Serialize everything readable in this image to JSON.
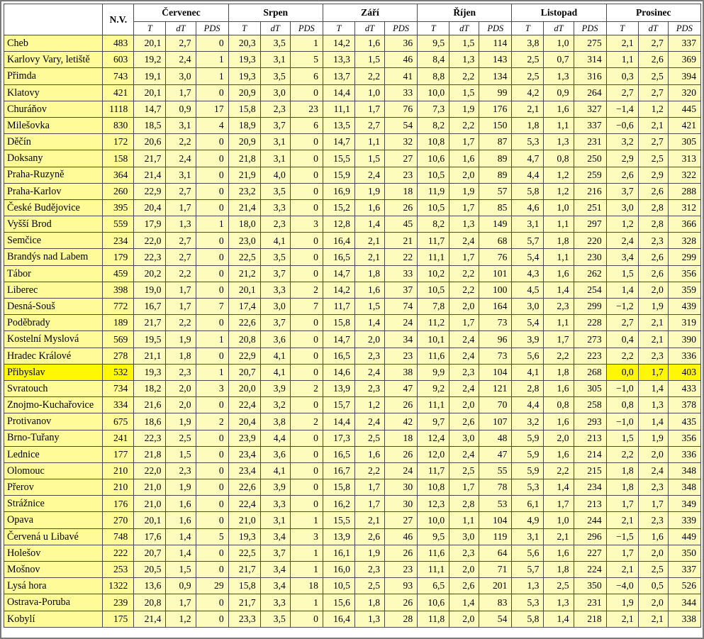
{
  "header": {
    "nv_label": "N.V.",
    "months": [
      "Červenec",
      "Srpen",
      "Září",
      "Říjen",
      "Listopad",
      "Prosinec"
    ],
    "subcols": [
      "T",
      "dT",
      "PDS"
    ]
  },
  "highlight_color": "#fff704",
  "rows": [
    {
      "name": "Cheb",
      "nv": "483",
      "v": [
        "20,1",
        "2,7",
        "0",
        "20,3",
        "3,5",
        "1",
        "14,2",
        "1,6",
        "36",
        "9,5",
        "1,5",
        "114",
        "3,8",
        "1,0",
        "275",
        "2,1",
        "2,7",
        "337"
      ]
    },
    {
      "name": "Karlovy Vary, letiště",
      "nv": "603",
      "v": [
        "19,2",
        "2,4",
        "1",
        "19,3",
        "3,1",
        "5",
        "13,3",
        "1,5",
        "46",
        "8,4",
        "1,3",
        "143",
        "2,5",
        "0,7",
        "314",
        "1,1",
        "2,6",
        "369"
      ]
    },
    {
      "name": "Přimda",
      "nv": "743",
      "v": [
        "19,1",
        "3,0",
        "1",
        "19,3",
        "3,5",
        "6",
        "13,7",
        "2,2",
        "41",
        "8,8",
        "2,2",
        "134",
        "2,5",
        "1,3",
        "316",
        "0,3",
        "2,5",
        "394"
      ]
    },
    {
      "name": "Klatovy",
      "nv": "421",
      "v": [
        "20,1",
        "1,7",
        "0",
        "20,9",
        "3,0",
        "0",
        "14,4",
        "1,0",
        "33",
        "10,0",
        "1,5",
        "99",
        "4,2",
        "0,9",
        "264",
        "2,7",
        "2,7",
        "320"
      ]
    },
    {
      "name": "Churáňov",
      "nv": "1118",
      "v": [
        "14,7",
        "0,9",
        "17",
        "15,8",
        "2,3",
        "23",
        "11,1",
        "1,7",
        "76",
        "7,3",
        "1,9",
        "176",
        "2,1",
        "1,6",
        "327",
        "−1,4",
        "1,2",
        "445"
      ]
    },
    {
      "name": "Milešovka",
      "nv": "830",
      "v": [
        "18,5",
        "3,1",
        "4",
        "18,9",
        "3,7",
        "6",
        "13,5",
        "2,7",
        "54",
        "8,2",
        "2,2",
        "150",
        "1,8",
        "1,1",
        "337",
        "−0,6",
        "2,1",
        "421"
      ]
    },
    {
      "name": "Děčín",
      "nv": "172",
      "v": [
        "20,6",
        "2,2",
        "0",
        "20,9",
        "3,1",
        "0",
        "14,7",
        "1,1",
        "32",
        "10,8",
        "1,7",
        "87",
        "5,3",
        "1,3",
        "231",
        "3,2",
        "2,7",
        "305"
      ]
    },
    {
      "name": "Doksany",
      "nv": "158",
      "v": [
        "21,7",
        "2,4",
        "0",
        "21,8",
        "3,1",
        "0",
        "15,5",
        "1,5",
        "27",
        "10,6",
        "1,6",
        "89",
        "4,7",
        "0,8",
        "250",
        "2,9",
        "2,5",
        "313"
      ]
    },
    {
      "name": "Praha-Ruzyně",
      "nv": "364",
      "v": [
        "21,4",
        "3,1",
        "0",
        "21,9",
        "4,0",
        "0",
        "15,9",
        "2,4",
        "23",
        "10,5",
        "2,0",
        "89",
        "4,4",
        "1,2",
        "259",
        "2,6",
        "2,9",
        "322"
      ]
    },
    {
      "name": "Praha-Karlov",
      "nv": "260",
      "v": [
        "22,9",
        "2,7",
        "0",
        "23,2",
        "3,5",
        "0",
        "16,9",
        "1,9",
        "18",
        "11,9",
        "1,9",
        "57",
        "5,8",
        "1,2",
        "216",
        "3,7",
        "2,6",
        "288"
      ]
    },
    {
      "name": "České Budějovice",
      "nv": "395",
      "v": [
        "20,4",
        "1,7",
        "0",
        "21,4",
        "3,3",
        "0",
        "15,2",
        "1,6",
        "26",
        "10,5",
        "1,7",
        "85",
        "4,6",
        "1,0",
        "251",
        "3,0",
        "2,8",
        "312"
      ]
    },
    {
      "name": "Vyšší Brod",
      "nv": "559",
      "v": [
        "17,9",
        "1,3",
        "1",
        "18,0",
        "2,3",
        "3",
        "12,8",
        "1,4",
        "45",
        "8,2",
        "1,3",
        "149",
        "3,1",
        "1,1",
        "297",
        "1,2",
        "2,8",
        "366"
      ]
    },
    {
      "name": "Semčice",
      "nv": "234",
      "v": [
        "22,0",
        "2,7",
        "0",
        "23,0",
        "4,1",
        "0",
        "16,4",
        "2,1",
        "21",
        "11,7",
        "2,4",
        "68",
        "5,7",
        "1,8",
        "220",
        "2,4",
        "2,3",
        "328"
      ]
    },
    {
      "name": "Brandýs nad Labem",
      "nv": "179",
      "v": [
        "22,3",
        "2,7",
        "0",
        "22,5",
        "3,5",
        "0",
        "16,5",
        "2,1",
        "22",
        "11,1",
        "1,7",
        "76",
        "5,4",
        "1,1",
        "230",
        "3,4",
        "2,6",
        "299"
      ]
    },
    {
      "name": "Tábor",
      "nv": "459",
      "v": [
        "20,2",
        "2,2",
        "0",
        "21,2",
        "3,7",
        "0",
        "14,7",
        "1,8",
        "33",
        "10,2",
        "2,2",
        "101",
        "4,3",
        "1,6",
        "262",
        "1,5",
        "2,6",
        "356"
      ]
    },
    {
      "name": "Liberec",
      "nv": "398",
      "v": [
        "19,0",
        "1,7",
        "0",
        "20,1",
        "3,3",
        "2",
        "14,2",
        "1,6",
        "37",
        "10,5",
        "2,2",
        "100",
        "4,5",
        "1,4",
        "254",
        "1,4",
        "2,0",
        "359"
      ]
    },
    {
      "name": "Desná-Souš",
      "nv": "772",
      "v": [
        "16,7",
        "1,7",
        "7",
        "17,4",
        "3,0",
        "7",
        "11,7",
        "1,5",
        "74",
        "7,8",
        "2,0",
        "164",
        "3,0",
        "2,3",
        "299",
        "−1,2",
        "1,9",
        "439"
      ]
    },
    {
      "name": "Poděbrady",
      "nv": "189",
      "v": [
        "21,7",
        "2,2",
        "0",
        "22,6",
        "3,7",
        "0",
        "15,8",
        "1,4",
        "24",
        "11,2",
        "1,7",
        "73",
        "5,4",
        "1,1",
        "228",
        "2,7",
        "2,1",
        "319"
      ]
    },
    {
      "name": "Kostelní Myslová",
      "nv": "569",
      "v": [
        "19,5",
        "1,9",
        "1",
        "20,8",
        "3,6",
        "0",
        "14,7",
        "2,0",
        "34",
        "10,1",
        "2,4",
        "96",
        "3,9",
        "1,7",
        "273",
        "0,4",
        "2,1",
        "390"
      ]
    },
    {
      "name": "Hradec Králové",
      "nv": "278",
      "v": [
        "21,1",
        "1,8",
        "0",
        "22,9",
        "4,1",
        "0",
        "16,5",
        "2,3",
        "23",
        "11,6",
        "2,4",
        "73",
        "5,6",
        "2,2",
        "223",
        "2,2",
        "2,3",
        "336"
      ]
    },
    {
      "name": "Přibyslav",
      "nv": "532",
      "v": [
        "19,3",
        "2,3",
        "1",
        "20,7",
        "4,1",
        "0",
        "14,6",
        "2,4",
        "38",
        "9,9",
        "2,3",
        "104",
        "4,1",
        "1,8",
        "268",
        "0,0",
        "1,7",
        "403"
      ],
      "highlight": true
    },
    {
      "name": "Svratouch",
      "nv": "734",
      "v": [
        "18,2",
        "2,0",
        "3",
        "20,0",
        "3,9",
        "2",
        "13,9",
        "2,3",
        "47",
        "9,2",
        "2,4",
        "121",
        "2,8",
        "1,6",
        "305",
        "−1,0",
        "1,4",
        "433"
      ]
    },
    {
      "name": "Znojmo-Kuchařovice",
      "nv": "334",
      "v": [
        "21,6",
        "2,0",
        "0",
        "22,4",
        "3,2",
        "0",
        "15,7",
        "1,2",
        "26",
        "11,1",
        "2,0",
        "70",
        "4,4",
        "0,8",
        "258",
        "0,8",
        "1,3",
        "378"
      ]
    },
    {
      "name": "Protivanov",
      "nv": "675",
      "v": [
        "18,6",
        "1,9",
        "2",
        "20,4",
        "3,8",
        "2",
        "14,4",
        "2,4",
        "42",
        "9,7",
        "2,6",
        "107",
        "3,2",
        "1,6",
        "293",
        "−1,0",
        "1,4",
        "435"
      ]
    },
    {
      "name": "Brno-Tuřany",
      "nv": "241",
      "v": [
        "22,3",
        "2,5",
        "0",
        "23,9",
        "4,4",
        "0",
        "17,3",
        "2,5",
        "18",
        "12,4",
        "3,0",
        "48",
        "5,9",
        "2,0",
        "213",
        "1,5",
        "1,9",
        "356"
      ]
    },
    {
      "name": "Lednice",
      "nv": "177",
      "v": [
        "21,8",
        "1,5",
        "0",
        "23,4",
        "3,6",
        "0",
        "16,5",
        "1,6",
        "26",
        "12,0",
        "2,4",
        "47",
        "5,9",
        "1,6",
        "214",
        "2,2",
        "2,0",
        "336"
      ]
    },
    {
      "name": "Olomouc",
      "nv": "210",
      "v": [
        "22,0",
        "2,3",
        "0",
        "23,4",
        "4,1",
        "0",
        "16,7",
        "2,2",
        "24",
        "11,7",
        "2,5",
        "55",
        "5,9",
        "2,2",
        "215",
        "1,8",
        "2,4",
        "348"
      ]
    },
    {
      "name": "Přerov",
      "nv": "210",
      "v": [
        "21,0",
        "1,9",
        "0",
        "22,6",
        "3,9",
        "0",
        "15,8",
        "1,7",
        "30",
        "10,8",
        "1,7",
        "78",
        "5,3",
        "1,4",
        "234",
        "1,8",
        "2,3",
        "348"
      ]
    },
    {
      "name": "Strážnice",
      "nv": "176",
      "v": [
        "21,0",
        "1,6",
        "0",
        "22,4",
        "3,3",
        "0",
        "16,2",
        "1,7",
        "30",
        "12,3",
        "2,8",
        "53",
        "6,1",
        "1,7",
        "213",
        "1,7",
        "1,7",
        "349"
      ]
    },
    {
      "name": "Opava",
      "nv": "270",
      "v": [
        "20,1",
        "1,6",
        "0",
        "21,0",
        "3,1",
        "1",
        "15,5",
        "2,1",
        "27",
        "10,0",
        "1,1",
        "104",
        "4,9",
        "1,0",
        "244",
        "2,1",
        "2,3",
        "339"
      ]
    },
    {
      "name": "Červená u Libavé",
      "nv": "748",
      "v": [
        "17,6",
        "1,4",
        "5",
        "19,3",
        "3,4",
        "3",
        "13,9",
        "2,6",
        "46",
        "9,5",
        "3,0",
        "119",
        "3,1",
        "2,1",
        "296",
        "−1,5",
        "1,6",
        "449"
      ]
    },
    {
      "name": "Holešov",
      "nv": "222",
      "v": [
        "20,7",
        "1,4",
        "0",
        "22,5",
        "3,7",
        "1",
        "16,1",
        "1,9",
        "26",
        "11,6",
        "2,3",
        "64",
        "5,6",
        "1,6",
        "227",
        "1,7",
        "2,0",
        "350"
      ]
    },
    {
      "name": "Mošnov",
      "nv": "253",
      "v": [
        "20,5",
        "1,5",
        "0",
        "21,7",
        "3,4",
        "1",
        "16,0",
        "2,3",
        "23",
        "11,1",
        "2,0",
        "71",
        "5,7",
        "1,8",
        "224",
        "2,1",
        "2,5",
        "337"
      ]
    },
    {
      "name": "Lysá hora",
      "nv": "1322",
      "v": [
        "13,6",
        "0,9",
        "29",
        "15,8",
        "3,4",
        "18",
        "10,5",
        "2,5",
        "93",
        "6,5",
        "2,6",
        "201",
        "1,3",
        "2,5",
        "350",
        "−4,0",
        "0,5",
        "526"
      ]
    },
    {
      "name": "Ostrava-Poruba",
      "nv": "239",
      "v": [
        "20,8",
        "1,7",
        "0",
        "21,7",
        "3,3",
        "1",
        "15,6",
        "1,8",
        "26",
        "10,6",
        "1,4",
        "83",
        "5,3",
        "1,3",
        "231",
        "1,9",
        "2,0",
        "344"
      ]
    },
    {
      "name": "Kobylí",
      "nv": "175",
      "v": [
        "21,4",
        "1,2",
        "0",
        "23,3",
        "3,5",
        "0",
        "16,4",
        "1,3",
        "28",
        "11,8",
        "2,0",
        "54",
        "5,8",
        "1,4",
        "218",
        "2,1",
        "2,1",
        "338"
      ]
    }
  ]
}
